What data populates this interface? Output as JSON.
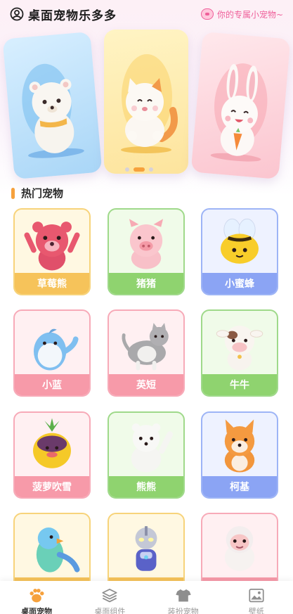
{
  "header": {
    "title": "桌面宠物乐多多",
    "subtitle": "你的专属小宠物~"
  },
  "carousel": {
    "slides": [
      {
        "animal": "white-bear"
      },
      {
        "animal": "white-cat"
      },
      {
        "animal": "white-rabbit"
      }
    ],
    "active_index": 1,
    "dot_count": 3
  },
  "section": {
    "title": "热门宠物"
  },
  "pets": [
    {
      "name": "草莓熊",
      "theme": "yellow"
    },
    {
      "name": "猪猪",
      "theme": "green"
    },
    {
      "name": "小蜜蜂",
      "theme": "blue"
    },
    {
      "name": "小蓝",
      "theme": "pink"
    },
    {
      "name": "英短",
      "theme": "pink"
    },
    {
      "name": "牛牛",
      "theme": "green"
    },
    {
      "name": "菠萝吹雪",
      "theme": "pink"
    },
    {
      "name": "熊熊",
      "theme": "green"
    },
    {
      "name": "柯基",
      "theme": "blue"
    },
    {
      "name": "",
      "theme": "yellow"
    },
    {
      "name": "",
      "theme": "yellow"
    },
    {
      "name": "",
      "theme": "pink"
    }
  ],
  "nav": {
    "items": [
      {
        "label": "桌面宠物",
        "icon": "paw-icon",
        "active": true
      },
      {
        "label": "桌面组件",
        "icon": "layers-icon",
        "active": false
      },
      {
        "label": "装扮宠物",
        "icon": "tshirt-icon",
        "active": false
      },
      {
        "label": "壁纸",
        "icon": "picture-icon",
        "active": false
      }
    ],
    "active_color": "#f6a13c"
  },
  "colors": {
    "accent": "#f6a13c",
    "pink": "#ef5f9a"
  }
}
